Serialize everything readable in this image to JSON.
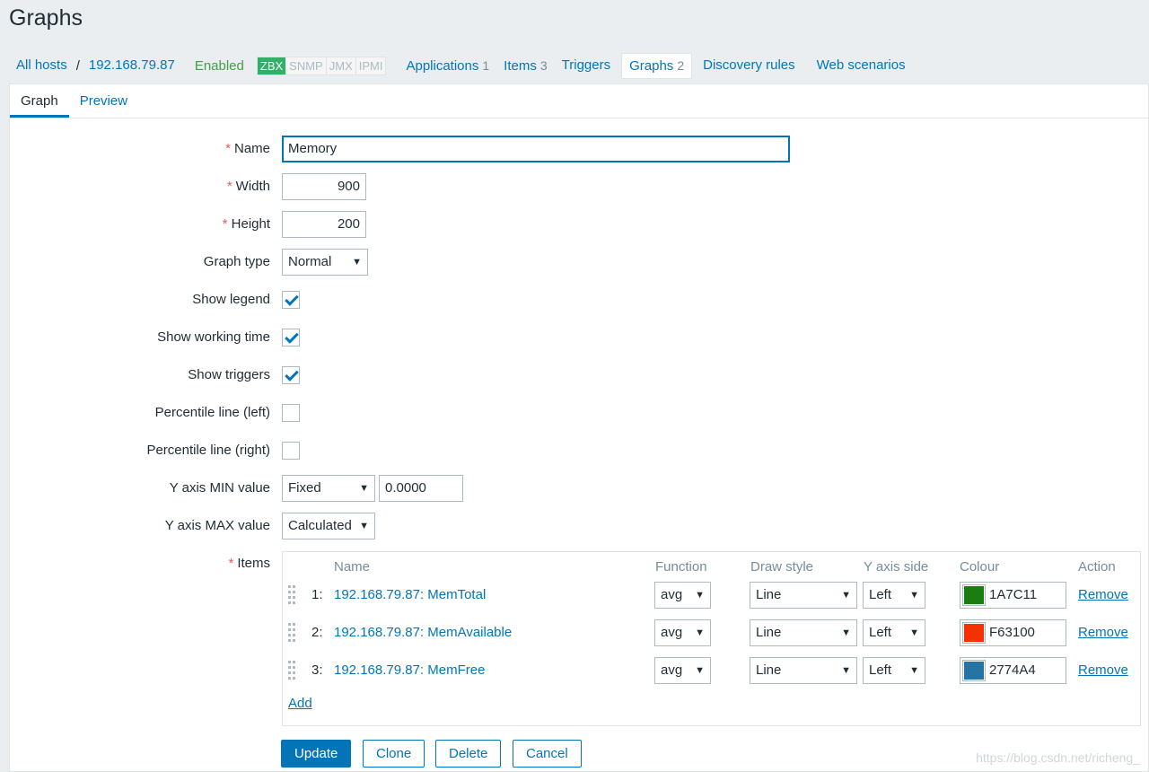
{
  "page": {
    "title": "Graphs"
  },
  "host_nav": {
    "all_hosts": "All hosts",
    "host": "192.168.79.87",
    "status": "Enabled",
    "badges": [
      "ZBX",
      "SNMP",
      "JMX",
      "IPMI"
    ],
    "applications": {
      "label": "Applications",
      "count": "1"
    },
    "items": {
      "label": "Items",
      "count": "3"
    },
    "triggers": {
      "label": "Triggers"
    },
    "graphs": {
      "label": "Graphs",
      "count": "2"
    },
    "discovery": {
      "label": "Discovery rules"
    },
    "web": {
      "label": "Web scenarios"
    }
  },
  "tabs": [
    "Graph",
    "Preview"
  ],
  "form": {
    "name": {
      "label": "Name",
      "value": "Memory"
    },
    "width": {
      "label": "Width",
      "value": "900"
    },
    "height": {
      "label": "Height",
      "value": "200"
    },
    "graph_type": {
      "label": "Graph type",
      "value": "Normal"
    },
    "show_legend": {
      "label": "Show legend",
      "checked": true
    },
    "show_working_time": {
      "label": "Show working time",
      "checked": true
    },
    "show_triggers": {
      "label": "Show triggers",
      "checked": true
    },
    "percentile_left": {
      "label": "Percentile line (left)",
      "checked": false
    },
    "percentile_right": {
      "label": "Percentile line (right)",
      "checked": false
    },
    "y_min": {
      "label": "Y axis MIN value",
      "type": "Fixed",
      "value": "0.0000"
    },
    "y_max": {
      "label": "Y axis MAX value",
      "type": "Calculated"
    },
    "items_label": "Items",
    "items_headers": {
      "name": "Name",
      "function": "Function",
      "draw_style": "Draw style",
      "y_axis_side": "Y axis side",
      "colour": "Colour",
      "action": "Action"
    },
    "items": [
      {
        "index": "1:",
        "name": "192.168.79.87: MemTotal",
        "function": "avg",
        "draw_style": "Line",
        "y_axis_side": "Left",
        "colour": "1A7C11",
        "colour_hex": "#1A7C11",
        "action": "Remove"
      },
      {
        "index": "2:",
        "name": "192.168.79.87: MemAvailable",
        "function": "avg",
        "draw_style": "Line",
        "y_axis_side": "Left",
        "colour": "F63100",
        "colour_hex": "#F63100",
        "action": "Remove"
      },
      {
        "index": "3:",
        "name": "192.168.79.87: MemFree",
        "function": "avg",
        "draw_style": "Line",
        "y_axis_side": "Left",
        "colour": "2774A4",
        "colour_hex": "#2774A4",
        "action": "Remove"
      }
    ],
    "add_label": "Add"
  },
  "buttons": {
    "update": "Update",
    "clone": "Clone",
    "delete": "Delete",
    "cancel": "Cancel"
  },
  "watermark": "https://blog.csdn.net/richeng_",
  "colors": {
    "accent": "#0275b8",
    "enabled": "#429e47",
    "required": "#e45959"
  }
}
